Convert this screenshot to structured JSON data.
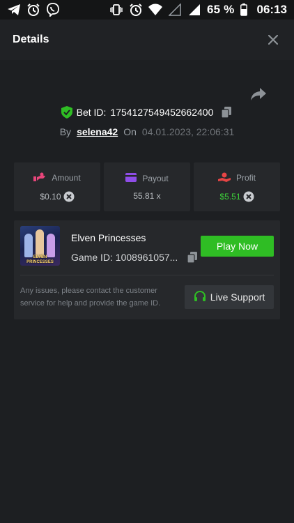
{
  "status_bar": {
    "battery_percent": "65 %",
    "time": "06:13",
    "left_icons": [
      "telegram-icon",
      "alarm-icon",
      "viber-icon"
    ],
    "right_icons": [
      "vibrate-icon",
      "alarm-icon",
      "wifi-icon",
      "signal-icon",
      "signal-icon",
      "battery-icon"
    ]
  },
  "header": {
    "title": "Details"
  },
  "bet": {
    "label": "Bet ID:",
    "id": "1754127549452662400",
    "by_label": "By",
    "username": "selena42",
    "on_label": "On",
    "date": "04.01.2023, 22:06:31"
  },
  "stats": {
    "amount": {
      "label": "Amount",
      "value": "$0.10"
    },
    "payout": {
      "label": "Payout",
      "value": "55.81 x"
    },
    "profit": {
      "label": "Profit",
      "value": "$5.51"
    }
  },
  "game": {
    "name": "Elven Princesses",
    "id_label": "Game ID: 1008961057...",
    "thumb_title_line1": "ELVEN",
    "thumb_title_line2": "PRINCESSES",
    "play_label": "Play Now",
    "support_text": "Any issues, please contact the customer service for help and provide the game ID.",
    "support_label": "Live Support"
  },
  "colors": {
    "background": "#1d1f22",
    "card": "#26282b",
    "accent_green": "#2fbd24",
    "profit_green": "#3dd13a",
    "amount_pink": "#e8457a",
    "payout_purple": "#8f4de8",
    "profit_red": "#e84545"
  }
}
